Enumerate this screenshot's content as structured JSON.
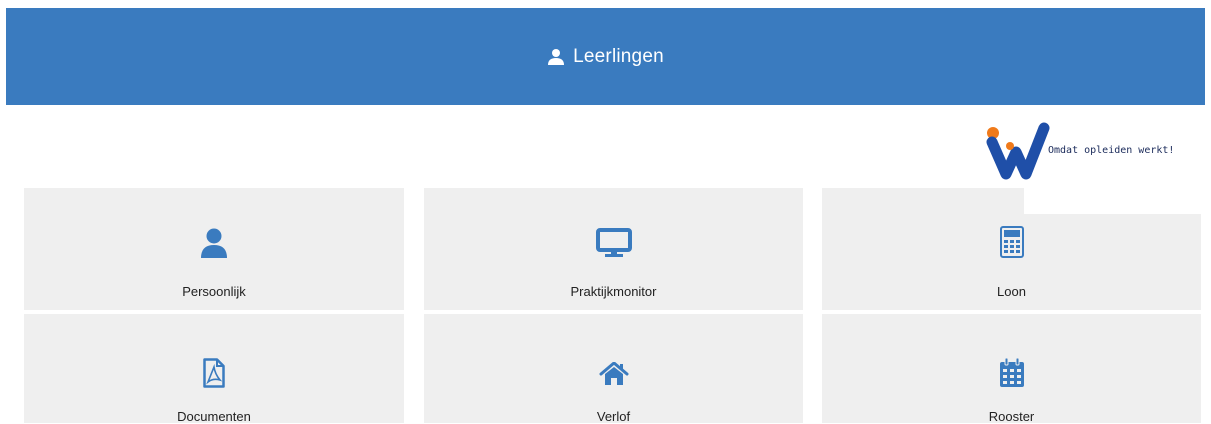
{
  "header": {
    "title": "Leerlingen",
    "icon": "user-icon",
    "background_color": "#3a7bbf"
  },
  "logo": {
    "tagline": "Omdat opleiden werkt!"
  },
  "tiles": [
    {
      "label": "Persoonlijk",
      "icon": "user-icon"
    },
    {
      "label": "Praktijkmonitor",
      "icon": "monitor-icon"
    },
    {
      "label": "Loon",
      "icon": "calculator-icon"
    },
    {
      "label": "Documenten",
      "icon": "pdf-file-icon"
    },
    {
      "label": "Verlof",
      "icon": "home-icon"
    },
    {
      "label": "Rooster",
      "icon": "calendar-icon"
    }
  ],
  "colors": {
    "accent": "#3a7bbf",
    "tile_background": "#efefef",
    "icon": "#3a7bbf"
  }
}
